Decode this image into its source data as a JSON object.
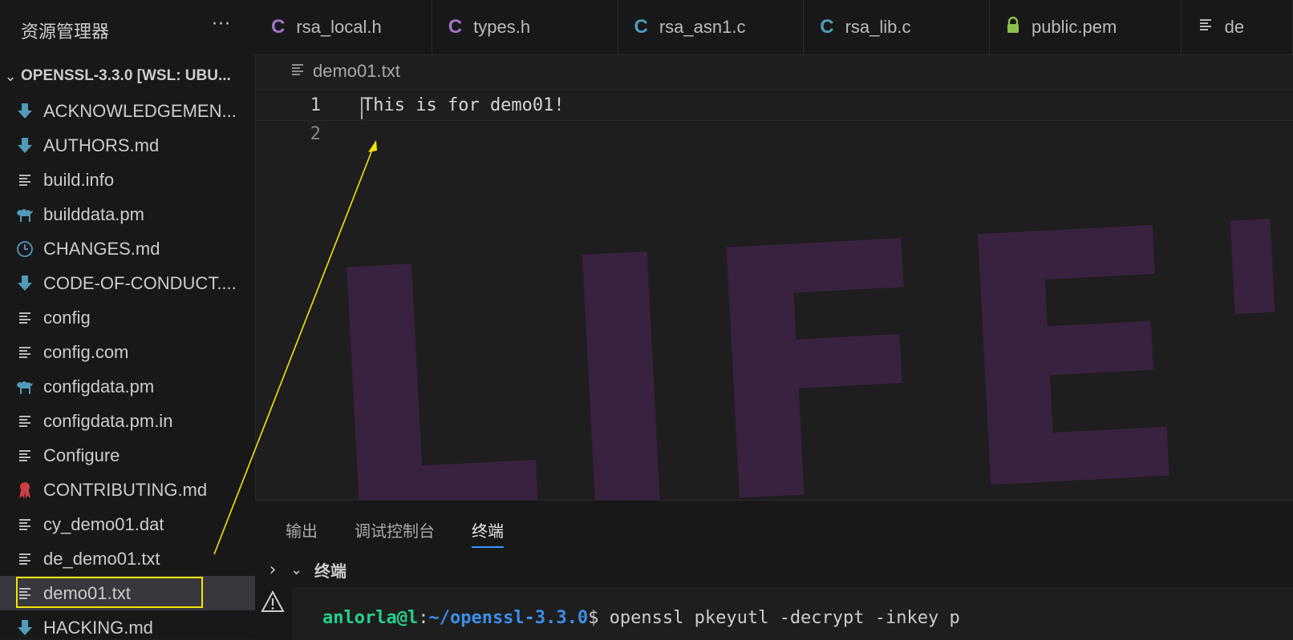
{
  "sidebar": {
    "title": "资源管理器",
    "more_label": "···",
    "project_name": "OPENSSL-3.3.0 [WSL: UBU...",
    "files": [
      {
        "name": "ACKNOWLEDGEMEN...",
        "icon": "markdown-download-icon",
        "color": "#519aba"
      },
      {
        "name": "AUTHORS.md",
        "icon": "markdown-download-icon",
        "color": "#519aba"
      },
      {
        "name": "build.info",
        "icon": "text-lines-icon",
        "color": "#cccccc"
      },
      {
        "name": "builddata.pm",
        "icon": "perl-camel-icon",
        "color": "#519aba"
      },
      {
        "name": "CHANGES.md",
        "icon": "clock-icon",
        "color": "#519aba"
      },
      {
        "name": "CODE-OF-CONDUCT....",
        "icon": "markdown-download-icon",
        "color": "#519aba"
      },
      {
        "name": "config",
        "icon": "text-lines-icon",
        "color": "#cccccc"
      },
      {
        "name": "config.com",
        "icon": "text-lines-icon",
        "color": "#cccccc"
      },
      {
        "name": "configdata.pm",
        "icon": "perl-camel-icon",
        "color": "#519aba"
      },
      {
        "name": "configdata.pm.in",
        "icon": "text-lines-icon",
        "color": "#cccccc"
      },
      {
        "name": "Configure",
        "icon": "text-lines-icon",
        "color": "#cccccc"
      },
      {
        "name": "CONTRIBUTING.md",
        "icon": "ribbon-icon",
        "color": "#cc3e44"
      },
      {
        "name": "cy_demo01.dat",
        "icon": "text-lines-icon",
        "color": "#cccccc"
      },
      {
        "name": "de_demo01.txt",
        "icon": "text-lines-icon",
        "color": "#cccccc"
      },
      {
        "name": "demo01.txt",
        "icon": "text-lines-icon",
        "color": "#cccccc",
        "selected": true
      },
      {
        "name": "HACKING.md",
        "icon": "markdown-download-icon",
        "color": "#519aba"
      }
    ]
  },
  "tabs": [
    {
      "label": "rsa_local.h",
      "icon": "C",
      "color": "#a074c4"
    },
    {
      "label": "types.h",
      "icon": "C",
      "color": "#a074c4"
    },
    {
      "label": "rsa_asn1.c",
      "icon": "C",
      "color": "#519aba"
    },
    {
      "label": "rsa_lib.c",
      "icon": "C",
      "color": "#519aba"
    },
    {
      "label": "public.pem",
      "icon": "lock-icon",
      "color": "#8dc149"
    },
    {
      "label": "de",
      "icon": "text-lines-icon",
      "color": "#cccccc"
    }
  ],
  "editor": {
    "breadcrumb": "demo01.txt",
    "lines": [
      {
        "number": "1",
        "text": "This is for demo01!"
      },
      {
        "number": "2",
        "text": ""
      }
    ]
  },
  "watermark_text": "LIFE'S N",
  "panel": {
    "tabs": [
      "输出",
      "调试控制台",
      "终端"
    ],
    "active_tab_index": 2,
    "terminal_title": "终端",
    "prompt_user": "anlorla@l",
    "prompt_sep": ":",
    "prompt_path": "~/openssl-3.3.0",
    "command": "$ openssl pkeyutl -decrypt -inkey p"
  },
  "colors": {
    "highlight_box": "#f5e400",
    "annotation_arrow": "#f5e400",
    "terminal_user": "#23d18b",
    "terminal_path": "#3b8eea"
  }
}
